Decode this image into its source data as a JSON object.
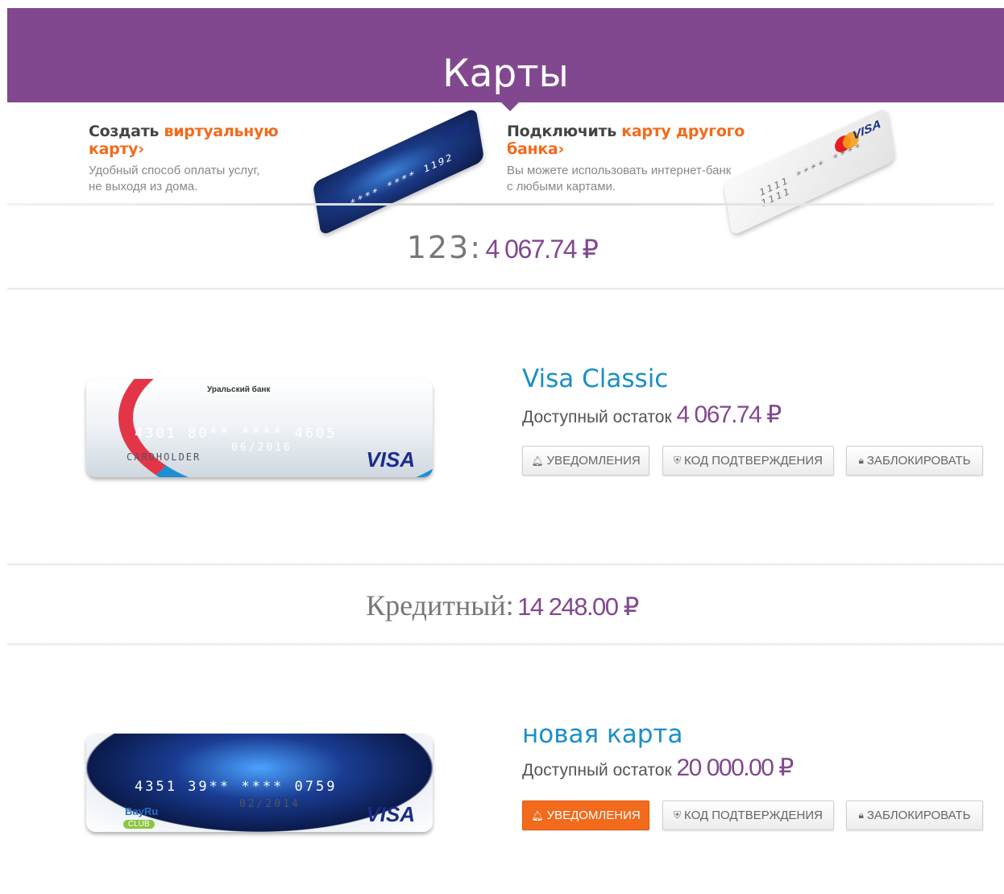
{
  "header": {
    "title": "Карты"
  },
  "promos": [
    {
      "title_prefix": "Создать",
      "title_highlight": "виртуальную карту",
      "arrow": "›",
      "desc_line1": "Удобный способ оплаты услуг,",
      "desc_line2": "не выходя из дома.",
      "card_visa": "VISA",
      "card_number": "**** **** 1192"
    },
    {
      "title_prefix": "Подключить",
      "title_highlight": "карту другого банка",
      "arrow": "›",
      "desc_line1": "Вы можете использовать интернет-банк",
      "desc_line2": "с любыми картами.",
      "card_visa": "VISA",
      "card_number": "1111 **** **** 1111"
    }
  ],
  "groups": [
    {
      "name": "123:",
      "sum": "4 067.74 ₽",
      "card": {
        "name": "Visa Classic",
        "avail_label": "Доступный остаток",
        "avail_amount": "4 067.74 ₽",
        "image": {
          "bank": "Уральский банк",
          "number": "4301 80** **** 4605",
          "expiry": "06/2016",
          "holder": "CARDHOLDER",
          "brand": "VISA"
        },
        "buttons": {
          "notify": "УВЕДОМЛЕНИЯ",
          "code": "КОД ПОДТВЕРЖДЕНИЯ",
          "block": "ЗАБЛОКИРОВАТЬ"
        },
        "notify_active": false
      }
    },
    {
      "name": "Кредитный:",
      "sum": "14 248.00 ₽",
      "card": {
        "name": "новая карта",
        "avail_label": "Доступный остаток",
        "avail_amount": "20 000.00 ₽",
        "image": {
          "number": "4351 39** **** 0759",
          "expiry": "02/2014",
          "logo": "BayRu",
          "club": "CLUB",
          "brand": "VISA"
        },
        "buttons": {
          "notify": "УВЕДОМЛЕНИЯ",
          "code": "КОД ПОДТВЕРЖДЕНИЯ",
          "block": "ЗАБЛОКИРОВАТЬ"
        },
        "notify_active": true
      }
    }
  ],
  "icons": {
    "notify": "bell-icon",
    "code": "shield-icon",
    "block": "lock-icon"
  },
  "colors": {
    "brand_purple": "#82488f",
    "accent_orange": "#f26a1c",
    "link_blue": "#1a8fc9"
  }
}
